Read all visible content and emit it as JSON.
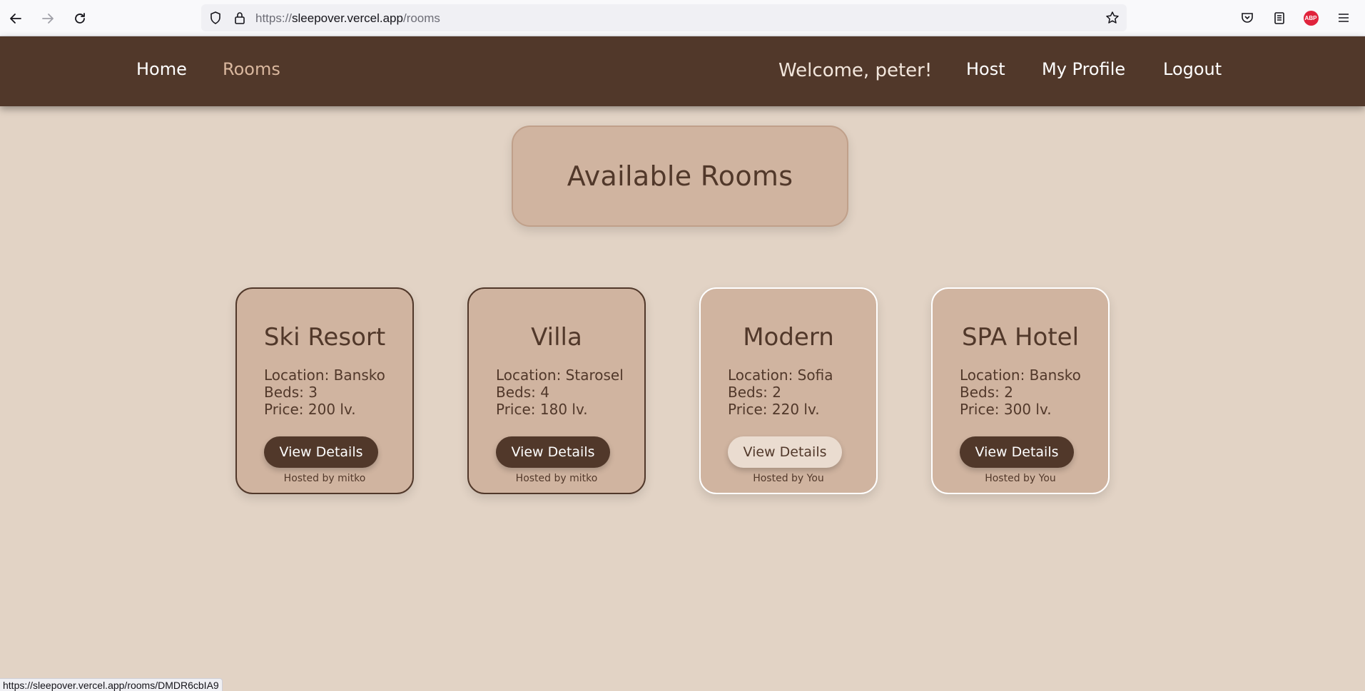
{
  "browser": {
    "url_scheme": "https://",
    "url_host": "sleepover.vercel.app",
    "url_path": "/rooms",
    "icons": [
      "back-icon",
      "forward-icon",
      "reload-icon",
      "shield-icon",
      "lock-icon",
      "star-icon",
      "pocket-icon",
      "reader-icon",
      "adblock-icon",
      "menu-icon"
    ],
    "adblock_label": "ABP",
    "status_text": "https://sleepover.vercel.app/rooms/DMDR6cbIA9"
  },
  "nav": {
    "home": "Home",
    "rooms": "Rooms",
    "welcome": "Welcome, peter!",
    "host": "Host",
    "profile": "My Profile",
    "logout": "Logout"
  },
  "page": {
    "title": "Available Rooms"
  },
  "rooms": [
    {
      "name": "Ski Resort",
      "location": "Location: Bansko",
      "beds": "Beds: 3",
      "price": "Price: 200 lv.",
      "button": "View Details",
      "host": "Hosted by mitko"
    },
    {
      "name": "Villa",
      "location": "Location: Starosel",
      "beds": "Beds: 4",
      "price": "Price: 180 lv.",
      "button": "View Details",
      "host": "Hosted by mitko"
    },
    {
      "name": "Modern",
      "location": "Location: Sofia",
      "beds": "Beds: 2",
      "price": "Price: 220 lv.",
      "button": "View Details",
      "host": "Hosted by You"
    },
    {
      "name": "SPA Hotel",
      "location": "Location: Bansko",
      "beds": "Beds: 2",
      "price": "Price: 300 lv.",
      "button": "View Details",
      "host": "Hosted by You"
    }
  ],
  "colors": {
    "nav_bg": "#51382a",
    "page_bg": "#e2d3c5",
    "card_bg": "#d0b4a0",
    "active_link": "#d9b79e"
  }
}
